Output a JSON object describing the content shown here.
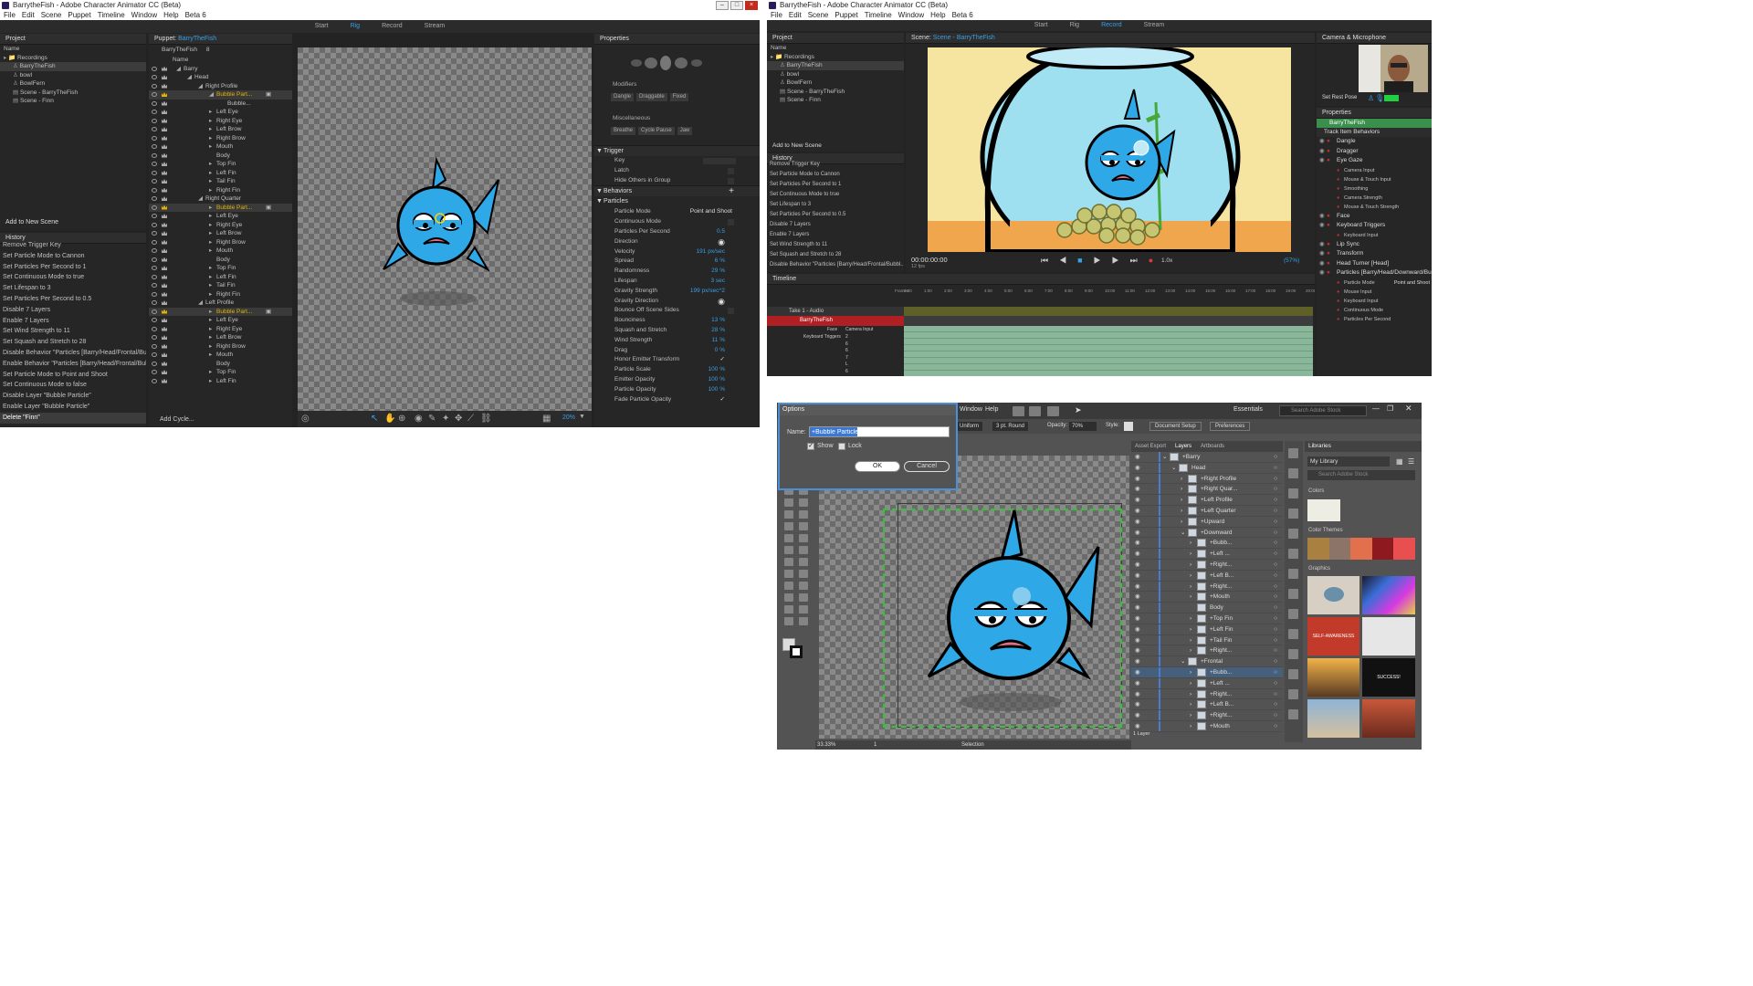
{
  "win1": {
    "title": "BarrytheFish - Adobe Character Animator CC (Beta)",
    "menu": [
      "File",
      "Edit",
      "Scene",
      "Puppet",
      "Timeline",
      "Window",
      "Help",
      "Beta 6"
    ],
    "modes": [
      "Start",
      "Rig",
      "Record",
      "Stream"
    ],
    "active_mode": "Rig",
    "project": {
      "header": "Project",
      "name_col": "Name",
      "items": [
        "Recordings",
        "BarryTheFish",
        "bowl",
        "BowlFern",
        "Scene - BarryTheFish",
        "Scene - Finn"
      ],
      "add_scene": "Add to New Scene"
    },
    "history": {
      "header": "History",
      "items": [
        "Remove Trigger Key",
        "Set Particle Mode to Cannon",
        "Set Particles Per Second to 1",
        "Set Continuous Mode to true",
        "Set Lifespan to 3",
        "Set Particles Per Second to 0.5",
        "Disable 7 Layers",
        "Enable 7 Layers",
        "Set Wind Strength to 11",
        "Set Squash and Stretch to 28",
        "Disable Behavior \"Particles [Barry/Head/Frontal/Bubbl...",
        "Enable Behavior \"Particles [Barry/Head/Frontal/Bubble...",
        "Set Particle Mode to Point and Shoot",
        "Set Continuous Mode to false",
        "Disable Layer \"Bubble Particle\"",
        "Enable Layer \"Bubble Particle\"",
        "Delete \"Finn\""
      ]
    },
    "puppet": {
      "header": "Puppet:",
      "puppet_name": "BarryTheFish",
      "name_row": "BarryTheFish",
      "count": "8",
      "name_col": "Name",
      "add_cycle": "Add Cycle...",
      "layers": [
        {
          "label": "Barry",
          "indent": 0,
          "tw": "down"
        },
        {
          "label": "Head",
          "indent": 1,
          "tw": "down"
        },
        {
          "label": "Right Profile",
          "indent": 2,
          "tw": "down"
        },
        {
          "label": "Bubble Part...",
          "indent": 3,
          "tw": "down",
          "hl": true
        },
        {
          "label": "Bubble...",
          "indent": 4,
          "tw": ""
        },
        {
          "label": "Left Eye",
          "indent": 3,
          "tw": "right"
        },
        {
          "label": "Right Eye",
          "indent": 3,
          "tw": "right"
        },
        {
          "label": "Left Brow",
          "indent": 3,
          "tw": "right"
        },
        {
          "label": "Right Brow",
          "indent": 3,
          "tw": "right"
        },
        {
          "label": "Mouth",
          "indent": 3,
          "tw": "right"
        },
        {
          "label": "Body",
          "indent": 3,
          "tw": ""
        },
        {
          "label": "Top Fin",
          "indent": 3,
          "tw": "right"
        },
        {
          "label": "Left Fin",
          "indent": 3,
          "tw": "right"
        },
        {
          "label": "Tail Fin",
          "indent": 3,
          "tw": "right"
        },
        {
          "label": "Right Fin",
          "indent": 3,
          "tw": "right"
        },
        {
          "label": "Right Quarter",
          "indent": 2,
          "tw": "down"
        },
        {
          "label": "Bubble Part...",
          "indent": 3,
          "tw": "right",
          "hl": true
        },
        {
          "label": "Left Eye",
          "indent": 3,
          "tw": "right"
        },
        {
          "label": "Right Eye",
          "indent": 3,
          "tw": "right"
        },
        {
          "label": "Left Brow",
          "indent": 3,
          "tw": "right"
        },
        {
          "label": "Right Brow",
          "indent": 3,
          "tw": "right"
        },
        {
          "label": "Mouth",
          "indent": 3,
          "tw": "right"
        },
        {
          "label": "Body",
          "indent": 3,
          "tw": ""
        },
        {
          "label": "Top Fin",
          "indent": 3,
          "tw": "right"
        },
        {
          "label": "Left Fin",
          "indent": 3,
          "tw": "right"
        },
        {
          "label": "Tail Fin",
          "indent": 3,
          "tw": "right"
        },
        {
          "label": "Right Fin",
          "indent": 3,
          "tw": "right"
        },
        {
          "label": "Left Profile",
          "indent": 2,
          "tw": "down"
        },
        {
          "label": "Bubble Part...",
          "indent": 3,
          "tw": "right",
          "hl": true
        },
        {
          "label": "Left Eye",
          "indent": 3,
          "tw": "right"
        },
        {
          "label": "Right Eye",
          "indent": 3,
          "tw": "right"
        },
        {
          "label": "Left Brow",
          "indent": 3,
          "tw": "right"
        },
        {
          "label": "Right Brow",
          "indent": 3,
          "tw": "right"
        },
        {
          "label": "Mouth",
          "indent": 3,
          "tw": "right"
        },
        {
          "label": "Body",
          "indent": 3,
          "tw": ""
        },
        {
          "label": "Top Fin",
          "indent": 3,
          "tw": "right"
        },
        {
          "label": "Left Fin",
          "indent": 3,
          "tw": "right"
        }
      ]
    },
    "zoom": "20%",
    "properties": {
      "header": "Properties",
      "modifiers_label": "Modifiers",
      "modifiers": [
        "Dangle",
        "Draggable",
        "Fixed"
      ],
      "misc_label": "Miscellaneous",
      "misc": [
        "Breathe",
        "Cycle Pause",
        "Jaw"
      ],
      "trigger_header": "Trigger",
      "trigger_rows": [
        "Key",
        "Latch",
        "Hide Others in Group"
      ],
      "behaviors_header": "Behaviors",
      "particles_header": "Particles",
      "rows": [
        {
          "label": "Particle Mode",
          "value": "Point and Shoot"
        },
        {
          "label": "Continuous Mode",
          "value": ""
        },
        {
          "label": "Particles Per Second",
          "value": "0.5"
        },
        {
          "label": "Direction",
          "value": ""
        },
        {
          "label": "Velocity",
          "value": "191 px/sec"
        },
        {
          "label": "Spread",
          "value": "6 %"
        },
        {
          "label": "Randomness",
          "value": "29 %"
        },
        {
          "label": "Lifespan",
          "value": "3 sec"
        },
        {
          "label": "Gravity Strength",
          "value": "199 px/sec^2"
        },
        {
          "label": "Gravity Direction",
          "value": ""
        },
        {
          "label": "Bounce Off Scene Sides",
          "value": ""
        },
        {
          "label": "Bounciness",
          "value": "13 %"
        },
        {
          "label": "Squash and Stretch",
          "value": "28 %"
        },
        {
          "label": "Wind Strength",
          "value": "11 %"
        },
        {
          "label": "Drag",
          "value": "0 %"
        },
        {
          "label": "Honor Emitter Transform",
          "value": "✓"
        },
        {
          "label": "Particle Scale",
          "value": "100 %"
        },
        {
          "label": "Emitter Opacity",
          "value": "100 %"
        },
        {
          "label": "Particle Opacity",
          "value": "100 %"
        },
        {
          "label": "Fade Particle Opacity",
          "value": "✓"
        }
      ]
    }
  },
  "win2": {
    "title": "BarrytheFish - Adobe Character Animator CC (Beta)",
    "menu": [
      "File",
      "Edit",
      "Scene",
      "Puppet",
      "Timeline",
      "Window",
      "Help",
      "Beta 6"
    ],
    "modes": [
      "Start",
      "Rig",
      "Record",
      "Stream"
    ],
    "active_mode": "Record",
    "project": {
      "header": "Project",
      "name_col": "Name",
      "items": [
        "Recordings",
        "BarryTheFish",
        "bowl",
        "BowlFern",
        "Scene - BarryTheFish",
        "Scene - Finn"
      ],
      "add_scene": "Add to New Scene"
    },
    "history": {
      "header": "History",
      "items": [
        "Remove Trigger Key",
        "Set Particle Mode to Cannon",
        "Set Particles Per Second to 1",
        "Set Continuous Mode to true",
        "Set Lifespan to 3",
        "Set Particles Per Second to 0.5",
        "Disable 7 Layers",
        "Enable 7 Layers",
        "Set Wind Strength to 11",
        "Set Squash and Stretch to 28",
        "Disable Behavior \"Particles [Barry/Head/Frontal/Bubbl..."
      ]
    },
    "scene": {
      "header": "Scene:",
      "name": "Scene - BarryTheFish",
      "timecode": "00:00:00:00",
      "fps": "12 fps",
      "speed": "1.0x",
      "zoom": "(57%)"
    },
    "timeline": {
      "header": "Timeline",
      "ruler": [
        "Frames",
        "0:00",
        "1:00",
        "2:00",
        "3:00",
        "4:00",
        "5:00",
        "6:00",
        "7:00",
        "8:00",
        "9:00",
        "10:00",
        "11:00",
        "12:00",
        "13:00",
        "14:00",
        "15:00",
        "16:00",
        "17:00",
        "18:00",
        "19:00",
        "20:00"
      ],
      "tracks": [
        "Take 1 - Audio",
        "BarryTheFish"
      ],
      "sub1": [
        "Face",
        "Camera Input"
      ],
      "sub2": [
        "Keyboard Triggers",
        "2",
        "6",
        "6",
        "7",
        "L",
        "6"
      ]
    },
    "camera": {
      "header": "Camera & Microphone",
      "set_rest_pose": "Set Rest Pose"
    },
    "properties": {
      "header": "Properties",
      "puppet": "BarryTheFish",
      "track_header": "Track Item Behaviors",
      "behaviors": [
        {
          "label": "Dangle",
          "sub": []
        },
        {
          "label": "Dragger",
          "sub": []
        },
        {
          "label": "Eye Gaze",
          "sub": [
            "Camera Input",
            "Mouse & Touch Input",
            "Smoothing",
            "Camera Strength",
            "Mouse & Touch Strength"
          ]
        },
        {
          "label": "Face",
          "sub": []
        },
        {
          "label": "Keyboard Triggers",
          "sub": [
            "Keyboard Input"
          ]
        },
        {
          "label": "Lip Sync",
          "sub": []
        },
        {
          "label": "Transform",
          "sub": []
        },
        {
          "label": "Head Turner [Head]",
          "sub": []
        },
        {
          "label": "Particles [Barry/Head/Downward/Bubble...",
          "sub": [
            "Particle Mode",
            "Mouse Input",
            "Keyboard Input",
            "Continuous Mode",
            "Particles Per Second"
          ]
        }
      ],
      "particle_mode_value": "Point and Shoot"
    }
  },
  "win3": {
    "menu": [
      "Window",
      "Help"
    ],
    "essentials": "Essentials",
    "search_placeholder": "Search Adobe Stock",
    "control": {
      "uniform": "Uniform",
      "stroke": "3 pt. Round",
      "opacity_label": "Opacity:",
      "opacity": "70%",
      "style_label": "Style:",
      "doc_setup": "Document Setup",
      "preferences": "Preferences"
    },
    "dialog": {
      "title": "Options",
      "name_label": "Name:",
      "name_value": "+Bubble Particle",
      "show": "Show",
      "lock": "Lock",
      "ok": "OK",
      "cancel": "Cancel"
    },
    "layers_tabs": [
      "Asset Export",
      "Layers",
      "Artboards"
    ],
    "layers": [
      {
        "label": "+Barry",
        "indent": 0,
        "tw": "down"
      },
      {
        "label": "Head",
        "indent": 1,
        "tw": "down"
      },
      {
        "label": "+Right Profile",
        "indent": 2,
        "tw": "right"
      },
      {
        "label": "+Right Quar...",
        "indent": 2,
        "tw": "right"
      },
      {
        "label": "+Left Profile",
        "indent": 2,
        "tw": "right"
      },
      {
        "label": "+Left Quarter",
        "indent": 2,
        "tw": "right"
      },
      {
        "label": "+Upward",
        "indent": 2,
        "tw": "right"
      },
      {
        "label": "+Downward",
        "indent": 2,
        "tw": "down"
      },
      {
        "label": "+Bubb...",
        "indent": 3,
        "tw": "right"
      },
      {
        "label": "+Left ...",
        "indent": 3,
        "tw": "right"
      },
      {
        "label": "+Right...",
        "indent": 3,
        "tw": "right"
      },
      {
        "label": "+Left B...",
        "indent": 3,
        "tw": "right"
      },
      {
        "label": "+Right...",
        "indent": 3,
        "tw": "right"
      },
      {
        "label": "+Mouth",
        "indent": 3,
        "tw": "right"
      },
      {
        "label": "Body",
        "indent": 3,
        "tw": ""
      },
      {
        "label": "+Top Fin",
        "indent": 3,
        "tw": "right"
      },
      {
        "label": "+Left Fin",
        "indent": 3,
        "tw": "right"
      },
      {
        "label": "+Tail Fin",
        "indent": 3,
        "tw": "right"
      },
      {
        "label": "+Right...",
        "indent": 3,
        "tw": "right"
      },
      {
        "label": "+Frontal",
        "indent": 2,
        "tw": "down"
      },
      {
        "label": "+Bubb...",
        "indent": 3,
        "tw": "right",
        "sel": true
      },
      {
        "label": "+Left ...",
        "indent": 3,
        "tw": "right"
      },
      {
        "label": "+Right...",
        "indent": 3,
        "tw": "right"
      },
      {
        "label": "+Left B...",
        "indent": 3,
        "tw": "right"
      },
      {
        "label": "+Right...",
        "indent": 3,
        "tw": "right"
      },
      {
        "label": "+Mouth",
        "indent": 3,
        "tw": "right"
      }
    ],
    "layer_count": "1 Layer",
    "zoom": "33.33%",
    "artboard": "1",
    "status": "Selection",
    "libraries": {
      "header": "Libraries",
      "library": "My Library",
      "search_placeholder": "Search Adobe Stock",
      "colors_label": "Colors",
      "themes_label": "Color Themes",
      "graphics_label": "Graphics",
      "swatch": "#eeede4",
      "theme": [
        "#a9803f",
        "#8c7468",
        "#e3704c",
        "#8e1a1f",
        "#ea4f4f"
      ],
      "graphic_text": [
        "SELF-AWARENESS",
        "SUCCESS!"
      ]
    }
  }
}
